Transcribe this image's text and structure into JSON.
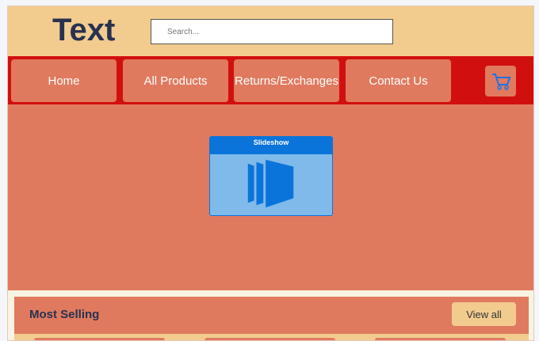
{
  "header": {
    "logo": "Text",
    "search_placeholder": "Search..."
  },
  "nav": {
    "items": [
      {
        "label": "Home"
      },
      {
        "label": "All Products"
      },
      {
        "label": "Returns/Exchanges"
      },
      {
        "label": "Contact Us"
      }
    ],
    "cart_icon": "shopping-cart-icon"
  },
  "hero": {
    "slideshow_label": "Slideshow"
  },
  "most_selling": {
    "title": "Most Selling",
    "view_all": "View all"
  },
  "colors": {
    "header": "#f2cc8f",
    "nav": "#d20f0f",
    "accent": "#e07a5f",
    "text": "#283250",
    "slideshow": "#0a74da"
  }
}
